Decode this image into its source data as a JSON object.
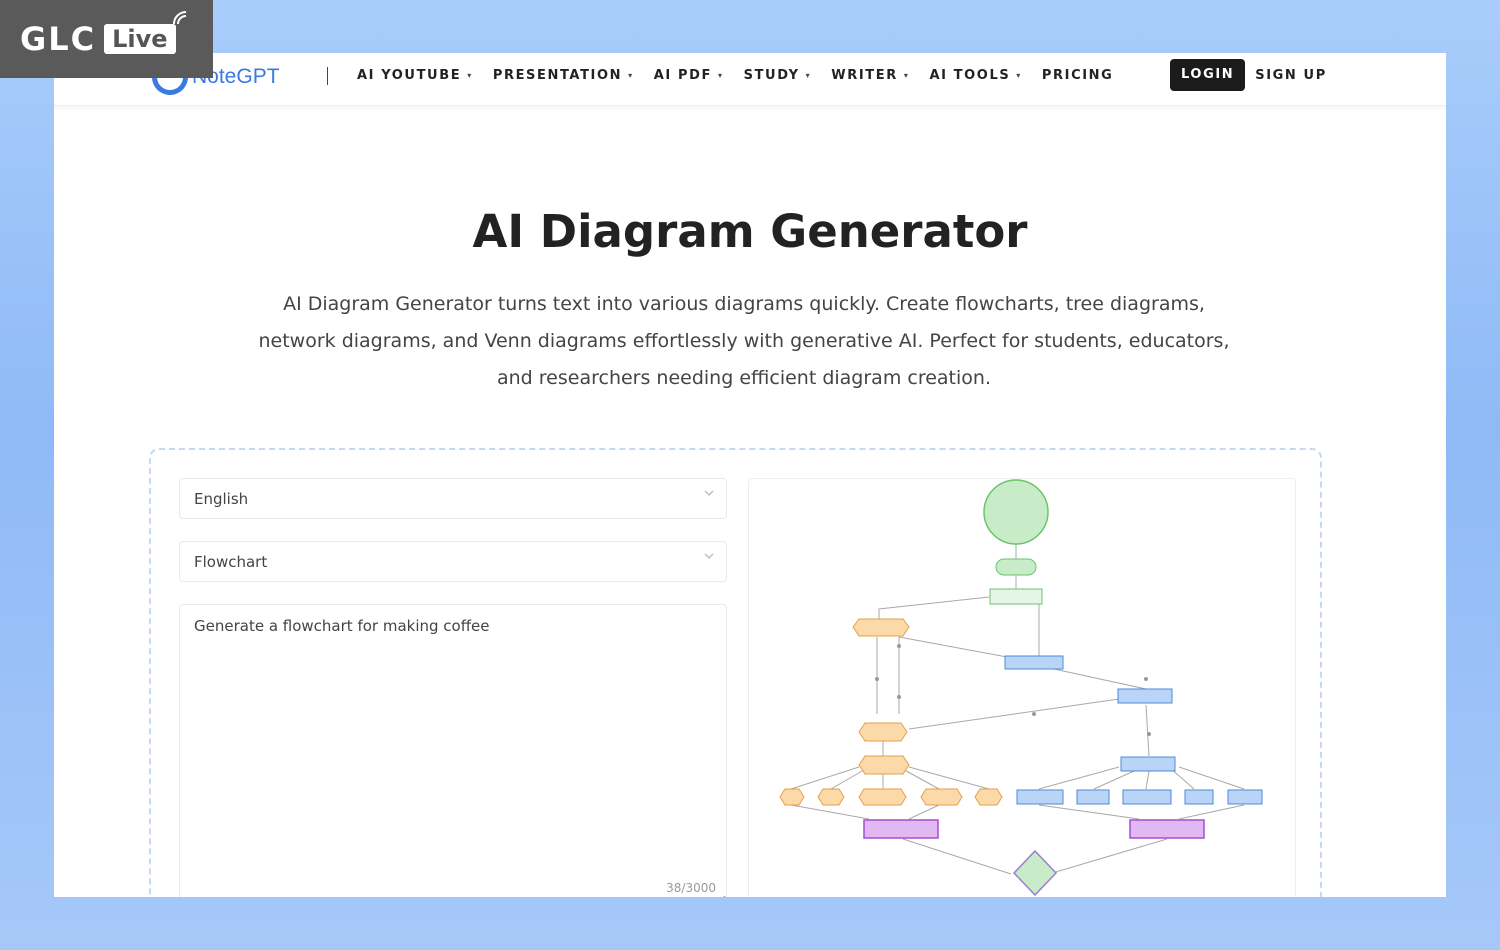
{
  "overlay": {
    "brand": "GLC",
    "live": "Live"
  },
  "nav": {
    "logo_text": "NoteGPT",
    "items": [
      {
        "label": "AI YOUTUBE",
        "dropdown": true
      },
      {
        "label": "PRESENTATION",
        "dropdown": true
      },
      {
        "label": "AI PDF",
        "dropdown": true
      },
      {
        "label": "STUDY",
        "dropdown": true
      },
      {
        "label": "WRITER",
        "dropdown": true
      },
      {
        "label": "AI TOOLS",
        "dropdown": true
      },
      {
        "label": "PRICING",
        "dropdown": false
      }
    ],
    "login": "LOGIN",
    "signup": "SIGN UP"
  },
  "hero": {
    "title": "AI Diagram Generator",
    "description": "AI Diagram Generator turns text into various diagrams quickly. Create flowcharts, tree diagrams, network diagrams, and Venn diagrams effortlessly with generative AI. Perfect for students, educators, and researchers needing efficient diagram creation."
  },
  "tool": {
    "language": "English",
    "diagram_type": "Flowchart",
    "prompt": "Generate a flowchart for making coffee",
    "counter": "38/3000"
  },
  "colors": {
    "accent": "#3b7ae0",
    "node_green": "#c8ecc8",
    "node_orange": "#fbd9a8",
    "node_blue": "#b8d4f6",
    "node_purple": "#e2b8f2"
  }
}
